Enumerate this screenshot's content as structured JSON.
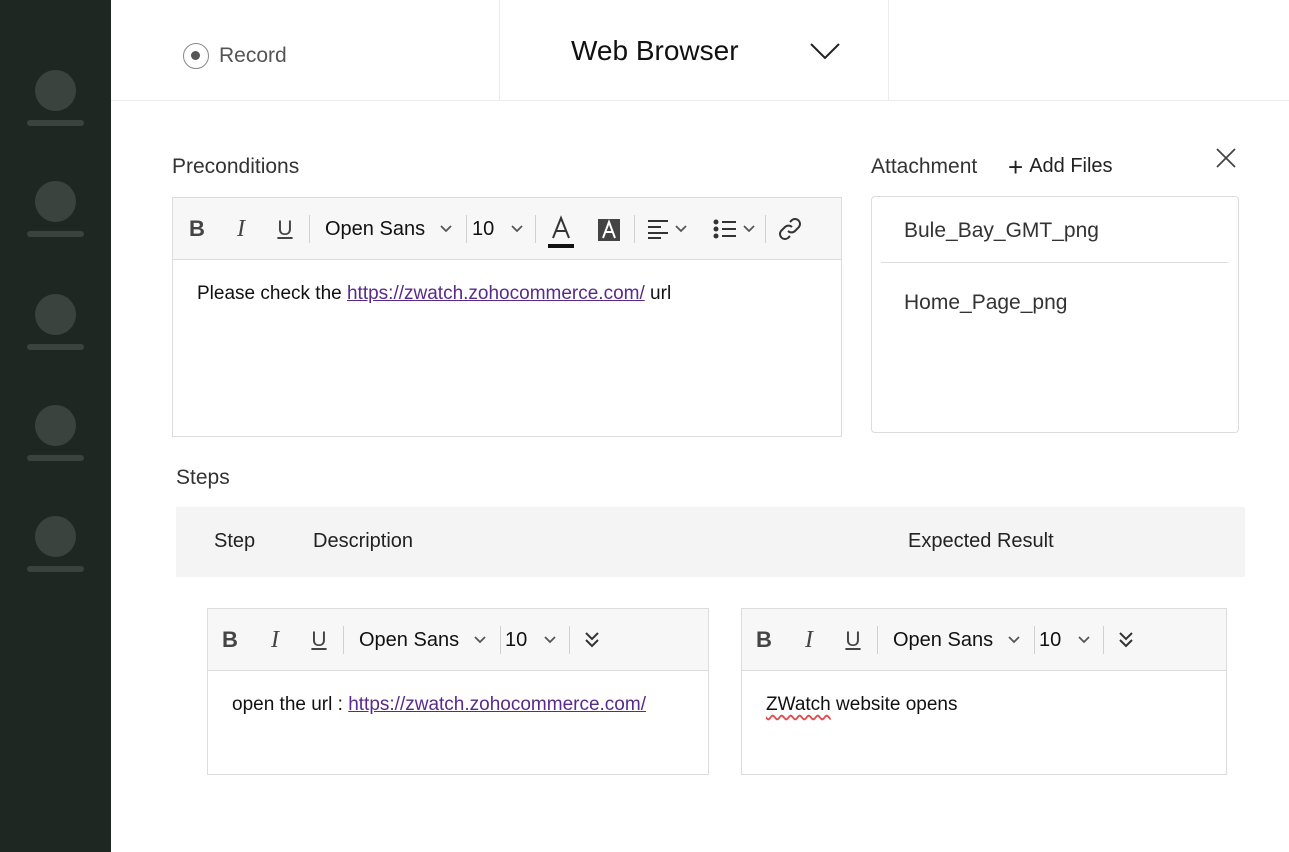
{
  "topbar": {
    "record_label": "Record",
    "browser_label": "Web Browser"
  },
  "preconditions": {
    "label": "Preconditions",
    "toolbar": {
      "bold": "B",
      "italic": "I",
      "underline": "U",
      "font": "Open Sans",
      "size": "10"
    },
    "text_before": "Please check the ",
    "link": "https://zwatch.zohocommerce.com/",
    "text_after": " url"
  },
  "attachment": {
    "label": "Attachment",
    "add_files": "Add Files",
    "files": [
      "Bule_Bay_GMT_png",
      "Home_Page_png"
    ]
  },
  "steps": {
    "label": "Steps",
    "columns": {
      "step": "Step",
      "description": "Description",
      "expected": "Expected Result"
    },
    "description_editor": {
      "toolbar": {
        "bold": "B",
        "italic": "I",
        "underline": "U",
        "font": "Open Sans",
        "size": "10"
      },
      "text_before": "open the url : ",
      "link": "https://zwatch.zohocommerce.com/"
    },
    "expected_editor": {
      "toolbar": {
        "bold": "B",
        "italic": "I",
        "underline": "U",
        "font": "Open Sans",
        "size": "10"
      },
      "misspelled": "ZWatch",
      "text_after": " website opens"
    }
  },
  "icons": [
    "radio-icon",
    "chevron-down-icon",
    "text-color-icon",
    "highlight-icon",
    "align-icon",
    "list-icon",
    "link-icon",
    "expand-more-icon",
    "close-icon",
    "plus-icon"
  ]
}
